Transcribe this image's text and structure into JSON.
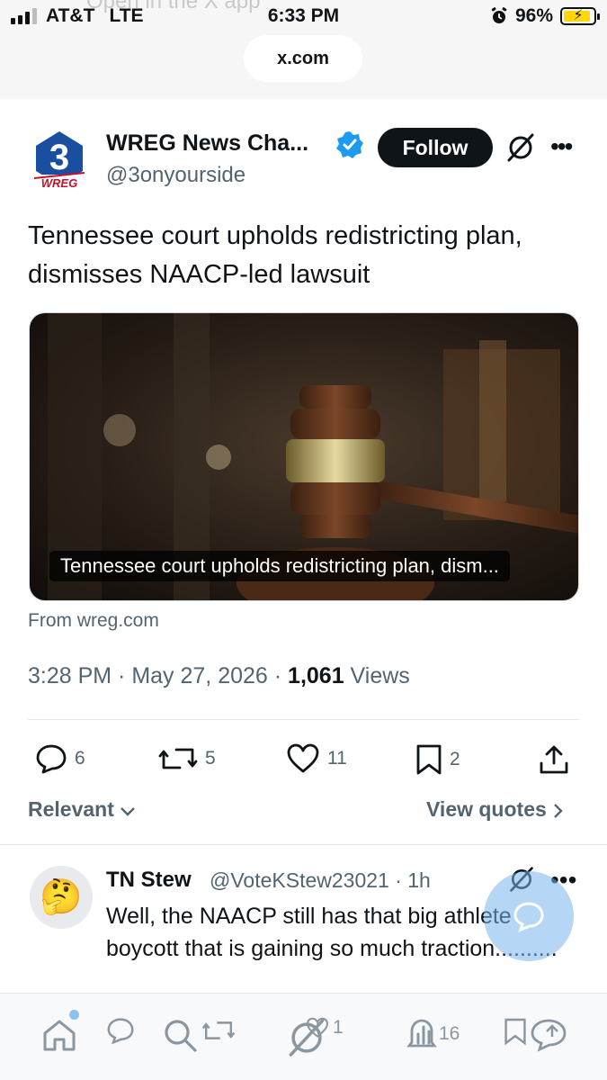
{
  "status_bar": {
    "carrier": "AT&T",
    "network": "LTE",
    "time": "6:33 PM",
    "battery": "96%",
    "ghost_text": "Open in the X app"
  },
  "browser": {
    "url": "x.com"
  },
  "tweet": {
    "author_name": "WREG News Cha...",
    "author_handle": "@3onyourside",
    "follow_label": "Follow",
    "text": "Tennessee court upholds redistricting plan, dismisses NAACP-led lawsuit",
    "card_caption": "Tennessee court upholds redistricting plan, dism...",
    "source": "From wreg.com",
    "time": "3:28 PM",
    "sep1": " · ",
    "date": "May 27, 2026",
    "sep2": " · ",
    "views_count": "1,061",
    "views_label": " Views",
    "actions": {
      "replies": "6",
      "reposts": "5",
      "likes": "11",
      "bookmarks": "2"
    },
    "sort_label": "Relevant",
    "view_quotes_label": "View quotes"
  },
  "reply": {
    "name": "TN Stew",
    "handle": "@VoteKStew23021 · 1h",
    "text": "Well, the NAACP still has that big athlete boycott that is gaining so much traction..........",
    "avatar_emoji": "🤔",
    "likes": "1",
    "views": "16"
  },
  "colors": {
    "accent": "#1d9bf0",
    "muted": "#536471",
    "text": "#0f1419"
  },
  "icons": [
    "reply-icon",
    "repost-icon",
    "like-icon",
    "bookmark-icon",
    "share-icon",
    "grok-icon",
    "more-icon",
    "verified-icon",
    "compose-icon"
  ]
}
